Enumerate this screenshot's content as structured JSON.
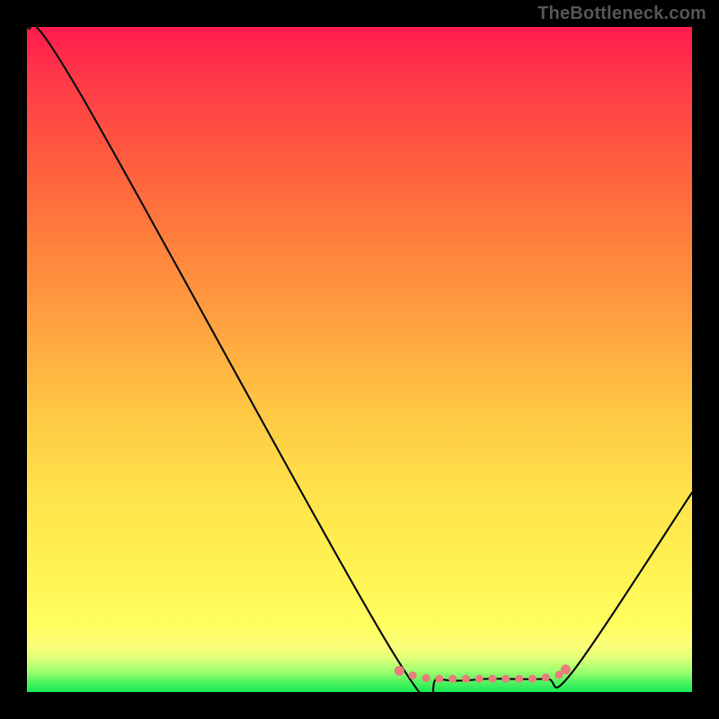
{
  "watermark": {
    "text": "TheBottleneck.com"
  },
  "chart_data": {
    "type": "line",
    "title": "",
    "xlabel": "",
    "ylabel": "",
    "xlim": [
      0,
      100
    ],
    "ylim": [
      0,
      100
    ],
    "series": [
      {
        "name": "curve",
        "x": [
          0,
          8,
          55,
          62,
          70,
          78,
          82,
          100
        ],
        "y": [
          100,
          90,
          6,
          2,
          2,
          2,
          3,
          30
        ]
      }
    ],
    "highlight_dots": {
      "name": "valley-dots",
      "x": [
        56,
        58,
        60,
        62,
        64,
        66,
        68,
        70,
        72,
        74,
        76,
        78,
        80,
        81
      ],
      "y": [
        3.2,
        2.5,
        2.1,
        2.0,
        2.0,
        2.0,
        2.0,
        2.0,
        2.0,
        2.0,
        2.0,
        2.2,
        2.6,
        3.4
      ]
    },
    "background_gradient": {
      "top": "#ff1a4d",
      "mid": "#ffe24a",
      "bottom": "#17e858"
    }
  }
}
